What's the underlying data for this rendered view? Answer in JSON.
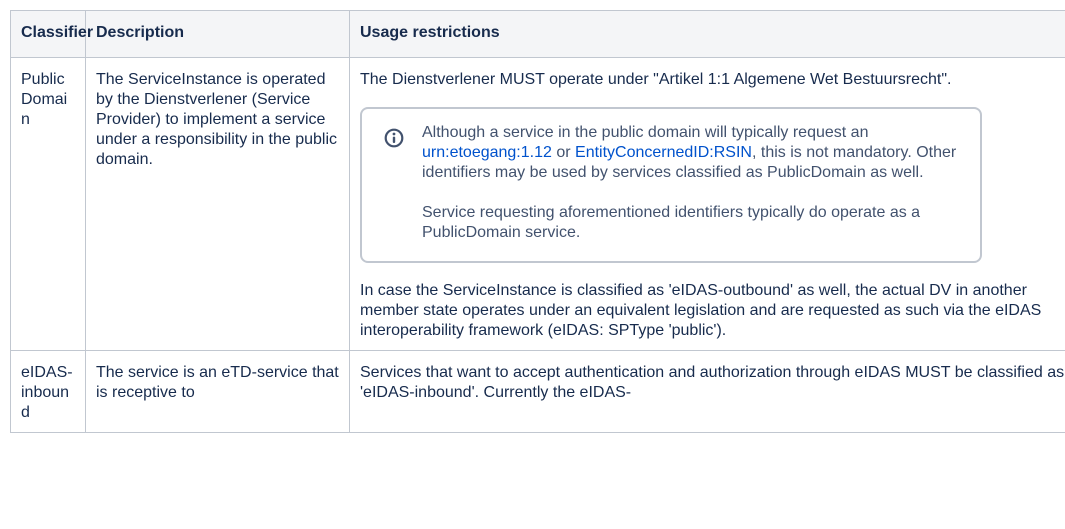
{
  "table": {
    "headers": {
      "classifier": "Classifier",
      "description": "Description",
      "usage": "Usage restrictions"
    },
    "rows": [
      {
        "classifier": "PublicDomain",
        "description": "The ServiceInstance is operated by the Dienstverlener (Service Provider) to implement a service under a responsibility in the public domain.",
        "usage_intro": "The Dienstverlener MUST operate under \"Artikel 1:1 Algemene Wet Bestuursrecht\".",
        "info_panel": {
          "icon": "info-icon",
          "p1_before": "Although a service in the public domain will typically request an ",
          "link1": "urn:etoegang:1.12",
          "p1_between": " or ",
          "link2": "EntityConcernedID:RSIN",
          "p1_after": ", this is not mandatory. Other identifiers may be used by services classified as PublicDomain as well.",
          "p2": "Service requesting aforementioned identifiers typically do operate as a PublicDomain service."
        },
        "usage_outro": "In case the ServiceInstance is classified as 'eIDAS-outbound' as well, the actual DV in another member state operates under an equivalent legislation and are requested as such via the eIDAS interoperability framework (eIDAS: SPType 'public')."
      },
      {
        "classifier": "eIDAS-inbound",
        "description": "The service is an eTD-service that is receptive to",
        "usage": "Services that want to accept authentication and authorization through eIDAS MUST be classified as 'eIDAS-inbound'. Currently the eIDAS-"
      }
    ]
  },
  "colors": {
    "text": "#172b4d",
    "muted_text": "#42526e",
    "link": "#0052cc",
    "border": "#c1c7d0",
    "header_bg": "#f4f5f7",
    "icon": "#42526e"
  }
}
